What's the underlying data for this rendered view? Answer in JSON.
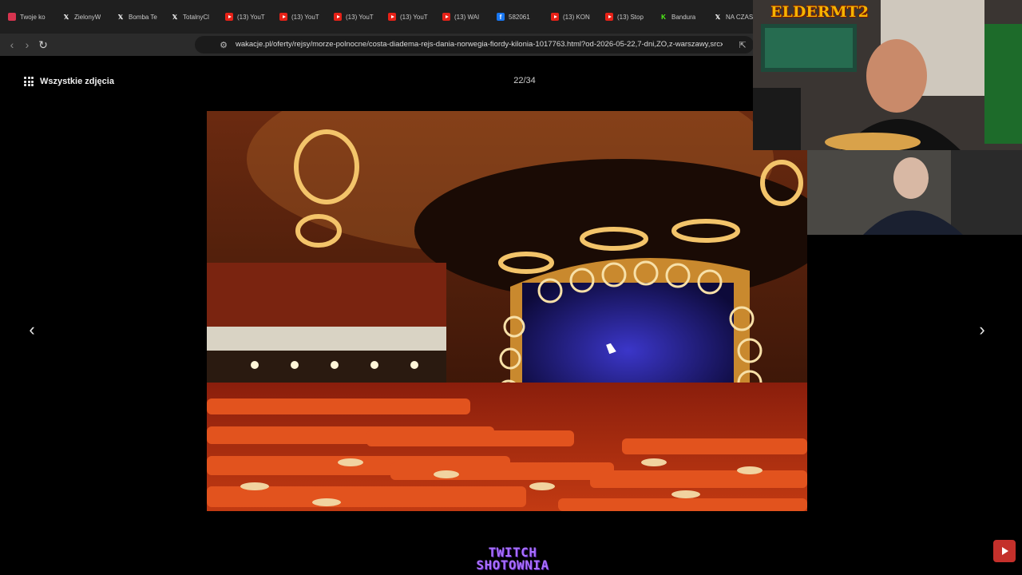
{
  "browser": {
    "tabs": [
      {
        "label": "Twoje ko",
        "icon": "red-dot-icon"
      },
      {
        "label": "ZielonyW",
        "icon": "x-icon"
      },
      {
        "label": "Bomba Te",
        "icon": "x-icon"
      },
      {
        "label": "TotalnyCl",
        "icon": "x-icon"
      },
      {
        "label": "(13) YouT",
        "icon": "youtube-icon"
      },
      {
        "label": "(13) YouT",
        "icon": "youtube-icon"
      },
      {
        "label": "(13) YouT",
        "icon": "youtube-icon"
      },
      {
        "label": "(13) YouT",
        "icon": "youtube-icon"
      },
      {
        "label": "(13) WAI",
        "icon": "youtube-icon"
      },
      {
        "label": "582061",
        "icon": "facebook-icon"
      },
      {
        "label": "(13) KON",
        "icon": "youtube-icon"
      },
      {
        "label": "(13) Stop",
        "icon": "youtube-icon"
      },
      {
        "label": "Bandura",
        "icon": "kick-icon"
      },
      {
        "label": "NA CZAS",
        "icon": "x-icon"
      }
    ],
    "url": "wakacje.pl/oferty/rejsy/morze-polnocne/costa-diadema-rejs-dania-norwegia-fiordy-kilonia-1017763.html?od-2026-05-22,7-dni,ZO,z-warszawy,srcx"
  },
  "gallery": {
    "all_photos_label": "Wszystkie zdjęcia",
    "counter": "22/34"
  },
  "overlay": {
    "streamer_logo": "ELDERMT2",
    "twitch_line1": "TWITCH",
    "twitch_line2": "SHOTOWNIA"
  },
  "colors": {
    "accent_twitch": "#a970ff",
    "youtube_red": "#e62117"
  }
}
